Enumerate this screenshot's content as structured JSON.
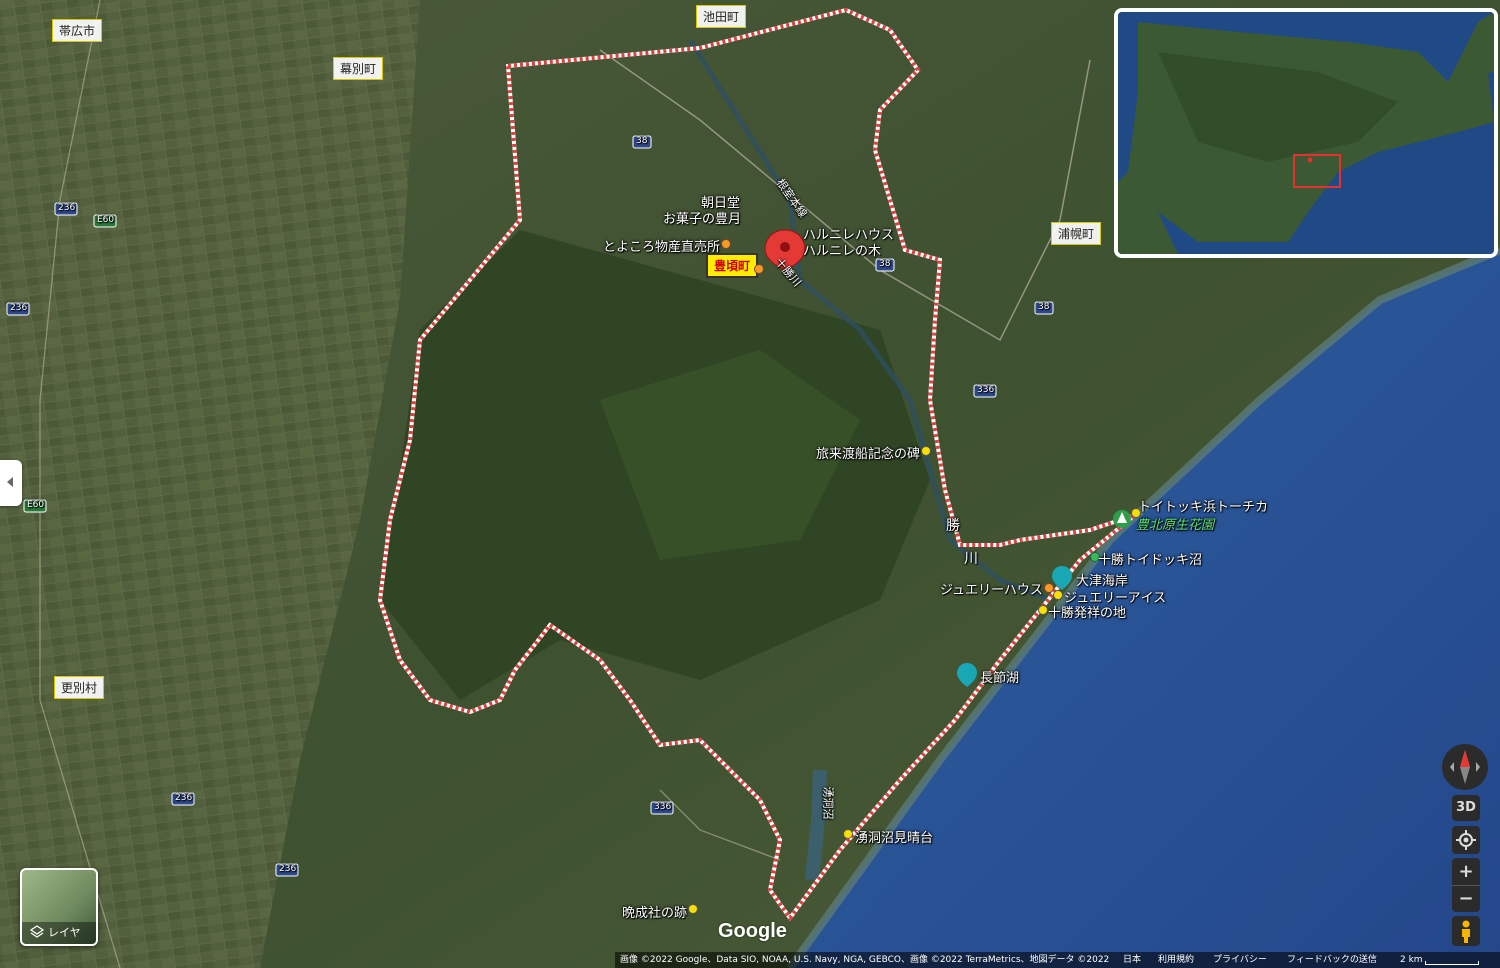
{
  "towns": {
    "obihiro": "帯広市",
    "ikeda": "池田町",
    "makubetsu": "幕別町",
    "urahoro": "浦幌町",
    "sarabetsu": "更別村",
    "toyokoro": "豊頃町"
  },
  "places": {
    "asahido": "朝日堂",
    "okashi": "お菓子の豊月",
    "bussan": "とよころ物産直売所",
    "haruniwa1": "ハルニレハウス",
    "haruniwa2": "ハルニレの木",
    "tabikoshi": "旅来渡船記念の碑",
    "toitokki_torchka": "トイトッキ浜トーチカ",
    "hokugen": "豊北原生花園",
    "toitokki_numa": "十勝トイドッキ沼",
    "otsu": "大津海岸",
    "jewelry_house": "ジュエリーハウス",
    "jewelry_ice": "ジュエリーアイス",
    "hasshou": "十勝発祥の地",
    "chobushi": "長節湖",
    "yudou": "湧洞沼見晴台",
    "bansei": "晩成社の跡"
  },
  "water": {
    "tokachi_river": "十勝川",
    "yudou_numa": "湧洞沼",
    "river_kanji1": "勝",
    "river_kanji2": "川"
  },
  "roads": {
    "r38a": "38",
    "r38b": "38",
    "r38c": "38",
    "r236a": "236",
    "r236b": "236",
    "r236c": "236",
    "r236d": "236",
    "r336a": "336",
    "r336b": "336",
    "e60a": "E60",
    "e60b": "E60",
    "nemuro": "根室本線"
  },
  "controls": {
    "three_d": "3D",
    "zoom_in": "+",
    "zoom_out": "−",
    "layers": "レイヤ",
    "google": "Google"
  },
  "attribution": {
    "imagery": "画像 ©2022 Google、Data SIO, NOAA, U.S. Navy, NGA, GEBCO、画像 ©2022 TerraMetrics、地図データ ©2022",
    "japan": "日本",
    "terms": "利用規約",
    "privacy": "プライバシー",
    "feedback": "フィードバックの送信",
    "scale": "2 km"
  },
  "colors": {
    "boundary": "#e04040",
    "pin": "#e53935",
    "sea": "#2a4f8c"
  }
}
